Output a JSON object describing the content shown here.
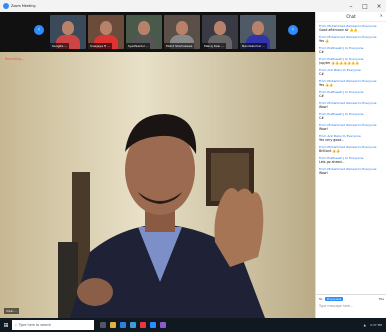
{
  "window": {
    "title": "Zoom Meeting"
  },
  "participants": [
    {
      "name": "Sangita ...",
      "bg": "#3b4a5a",
      "shirt": "#c44"
    },
    {
      "name": "Sreejaya H ...",
      "bg": "#6b4c3b",
      "shirt": "#d33"
    },
    {
      "name": "SyedSaidul ...",
      "bg": "#4a5a4a",
      "shirt": "#555"
    },
    {
      "name": "Mohd Shahnawaz",
      "bg": "#5b5047",
      "shirt": "#888"
    },
    {
      "name": "Manoj Kasi ...",
      "bg": "#3a3a44",
      "shirt": "#666"
    },
    {
      "name": "Nandakumar ...",
      "bg": "#4f5a66",
      "shirt": "#33a"
    }
  ],
  "stage": {
    "recording_label": "Recording...",
    "speaker_name": "Vipin ..."
  },
  "chat": {
    "header": "Chat",
    "messages": [
      {
        "from": "From Mohammed Zameel to Everyone",
        "text": "Good afternoon sir 👍👍"
      },
      {
        "from": "From Mohammed Zameel to Everyone",
        "text": "Yes 👍"
      },
      {
        "from": "From Pratheesh J to Everyone",
        "text": "C#"
      },
      {
        "from": "From Pratheesh J to Everyone",
        "text": "Jupyter 👍👍👍👍👍👍👍"
      },
      {
        "from": "From Anil Babu to Everyone",
        "text": "C#"
      },
      {
        "from": "From Mohammed Zameel to Everyone",
        "text": "Yes 👍👍"
      },
      {
        "from": "From Pratheesh J to Everyone",
        "text": "C#"
      },
      {
        "from": "From Mohammed Zameel to Everyone",
        "text": "Wow!"
      },
      {
        "from": "From Pratheesh J to Everyone",
        "text": "C#"
      },
      {
        "from": "From Mohammed Zameel to Everyone",
        "text": "Wow!"
      },
      {
        "from": "From Anil Babu to Everyone",
        "text": "Yes very good..."
      },
      {
        "from": "From Mohammed Zameel to Everyone",
        "text": "Brilliant 👍👍"
      },
      {
        "from": "From Pratheesh J to Everyone",
        "text": "Lets go ahead..."
      },
      {
        "from": "From Mohammed Zameel to Everyone",
        "text": "Wow!"
      }
    ],
    "to_label": "To:",
    "recipient": "Everyone",
    "file_label": "File",
    "input_placeholder": "Type message here..."
  },
  "taskbar": {
    "search_placeholder": "Type here to search",
    "clock": "4:37 PM"
  }
}
